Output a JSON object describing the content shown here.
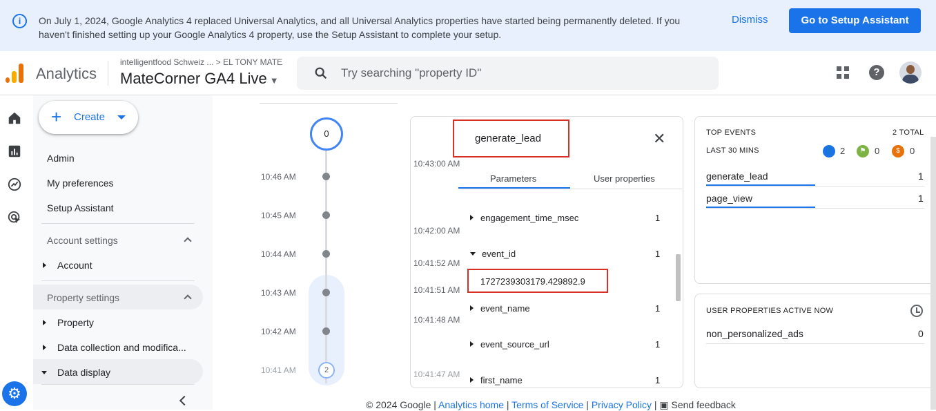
{
  "banner": {
    "message": "On July 1, 2024, Google Analytics 4 replaced Universal Analytics, and all Universal Analytics properties have started being permanently deleted. If you haven't finished setting up your Google Analytics 4 property, use the Setup Assistant to complete your setup.",
    "dismiss_label": "Dismiss",
    "setup_label": "Go to Setup Assistant"
  },
  "header": {
    "brand": "Analytics",
    "breadcrumb": "intelligentfood Schweiz ... > EL TONY MATE",
    "property": "MateCorner GA4 Live",
    "search_placeholder": "Try searching \"property ID\""
  },
  "sidebar": {
    "create_label": "Create",
    "admin": "Admin",
    "my_preferences": "My preferences",
    "setup_assistant": "Setup Assistant",
    "account_settings": "Account settings",
    "account": "Account",
    "property_settings": "Property settings",
    "property": "Property",
    "data_collection": "Data collection and modifica...",
    "data_display": "Data display"
  },
  "timeline": {
    "top_count": "0",
    "bottom_count": "2",
    "times": [
      "10:46 AM",
      "10:45 AM",
      "10:44 AM",
      "10:43 AM",
      "10:42 AM",
      "10:41 AM"
    ]
  },
  "event_card": {
    "title": "generate_lead",
    "times": [
      "10:43:00 AM",
      "10:42:00 AM",
      "10:41:52 AM",
      "10:41:51 AM",
      "10:41:48 AM",
      "10:41:47 AM"
    ],
    "tabs": [
      "Parameters",
      "User properties"
    ],
    "parameters": [
      {
        "name": "engagement_time_msec",
        "count": "1"
      },
      {
        "name": "event_id",
        "count": "1",
        "value": "1727239303179.429892.9"
      },
      {
        "name": "event_name",
        "count": "1"
      },
      {
        "name": "event_source_url",
        "count": "1"
      },
      {
        "name": "first_name",
        "count": "1"
      }
    ]
  },
  "top_events": {
    "title": "TOP EVENTS",
    "total": "2 TOTAL",
    "period": "LAST 30 MINS",
    "badges": {
      "users": "2",
      "conversions": "0",
      "ecommerce": "0"
    },
    "colors": {
      "users": "#1a73e8",
      "conversions": "#7cb342",
      "ecommerce": "#e8710a"
    },
    "events": [
      {
        "name": "generate_lead",
        "count": "1"
      },
      {
        "name": "page_view",
        "count": "1"
      }
    ]
  },
  "user_properties": {
    "title": "USER PROPERTIES ACTIVE NOW",
    "items": [
      {
        "name": "non_personalized_ads",
        "count": "0"
      }
    ]
  },
  "footer": {
    "copyright": "© 2024 Google |",
    "analytics_home": "Analytics home",
    "terms": "Terms of Service",
    "privacy": "Privacy Policy",
    "send_feedback": "Send feedback"
  }
}
